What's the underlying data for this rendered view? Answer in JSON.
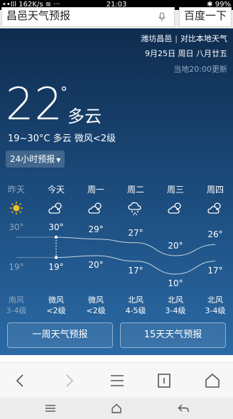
{
  "status": {
    "left": "••lll  162K/s ≋ ···",
    "time": "21:03",
    "right": "✱ 99%"
  },
  "search": {
    "query": "昌邑天气预报",
    "button": "百度一下"
  },
  "weather": {
    "location": "潍坊昌邑",
    "compare": "对比本地天气",
    "date": "9月25日 周日 八月廿五",
    "updated": "当地20:00更新",
    "temp": "22",
    "degree": "°",
    "condition": "多云",
    "summary": "19~30°C 多云 微风<2级",
    "forecast_toggle": "24小时预报",
    "forecast_caret": "▼",
    "days": [
      {
        "name": "昨天",
        "icon": "sunny-icon",
        "high": "30°",
        "low": "19°",
        "wind": "南风",
        "level": "3-4级",
        "past": true
      },
      {
        "name": "今天",
        "icon": "partly-cloudy-icon",
        "high": "30°",
        "low": "19°",
        "wind": "微风",
        "level": "<2级",
        "past": false
      },
      {
        "name": "周一",
        "icon": "partly-cloudy-icon",
        "high": "29°",
        "low": "20°",
        "wind": "微风",
        "level": "<2级",
        "past": false
      },
      {
        "name": "周二",
        "icon": "rain-icon",
        "high": "27°",
        "low": "17°",
        "wind": "北风",
        "level": "4-5级",
        "past": false
      },
      {
        "name": "周三",
        "icon": "partly-cloudy-icon",
        "high": "20°",
        "low": "10°",
        "wind": "北风",
        "level": "3-4级",
        "past": false
      },
      {
        "name": "周四",
        "icon": "partly-cloudy-icon",
        "high": "26°",
        "low": "17°",
        "wind": "北风",
        "level": "3-4级",
        "past": false
      }
    ],
    "week_button": "一周天气预报",
    "fifteen_button": "15天天气预报"
  },
  "chart_data": {
    "type": "line",
    "categories": [
      "昨天",
      "今天",
      "周一",
      "周二",
      "周三",
      "周四"
    ],
    "series": [
      {
        "values": [
          30,
          30,
          29,
          27,
          20,
          26
        ]
      },
      {
        "values": [
          19,
          19,
          20,
          17,
          10,
          17
        ]
      }
    ]
  },
  "colors": {
    "panel_top": "#0f2c4e",
    "panel_bottom": "#2b6aa5",
    "past_text": "#8fa8c4"
  }
}
